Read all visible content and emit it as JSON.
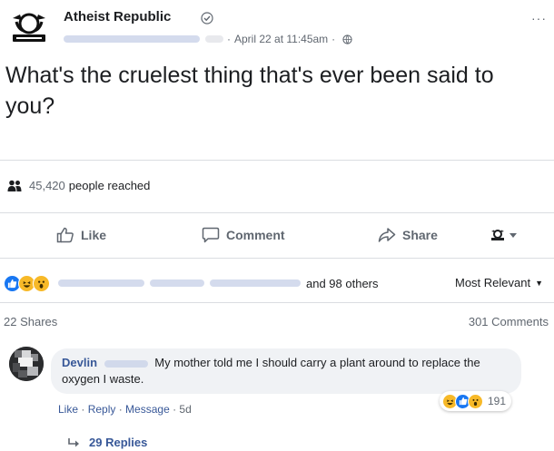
{
  "post": {
    "page_name": "Atheist Republic",
    "date": "April 22 at 11:45am",
    "separator": "·",
    "more": "···",
    "text": "What's the cruelest thing that's ever been said to you?",
    "reach_count": "45,420",
    "reach_label": "people reached"
  },
  "actions": {
    "like": "Like",
    "comment": "Comment",
    "share": "Share"
  },
  "reactions": {
    "others": "and 98 others",
    "sort": "Most Relevant",
    "shares": "22 Shares",
    "comments": "301 Comments"
  },
  "comment": {
    "author": "Devlin",
    "text": "My mother told me I should carry a plant around to replace the oxygen I waste.",
    "like": "Like",
    "reply": "Reply",
    "message": "Message",
    "age": "5d",
    "dot": " · ",
    "reaction_count": "191",
    "replies": "29 Replies"
  },
  "colors": {
    "link": "#385898",
    "like_blue": "#1877f2",
    "emoji_yellow": "#f7b928"
  },
  "icons": [
    "page-logo",
    "verified-icon",
    "globe-icon",
    "more-icon",
    "reach-icon",
    "like-icon",
    "comment-icon",
    "share-icon",
    "page-selector-icon",
    "like-reaction",
    "haha-reaction",
    "wow-reaction",
    "reply-arrow-icon"
  ]
}
